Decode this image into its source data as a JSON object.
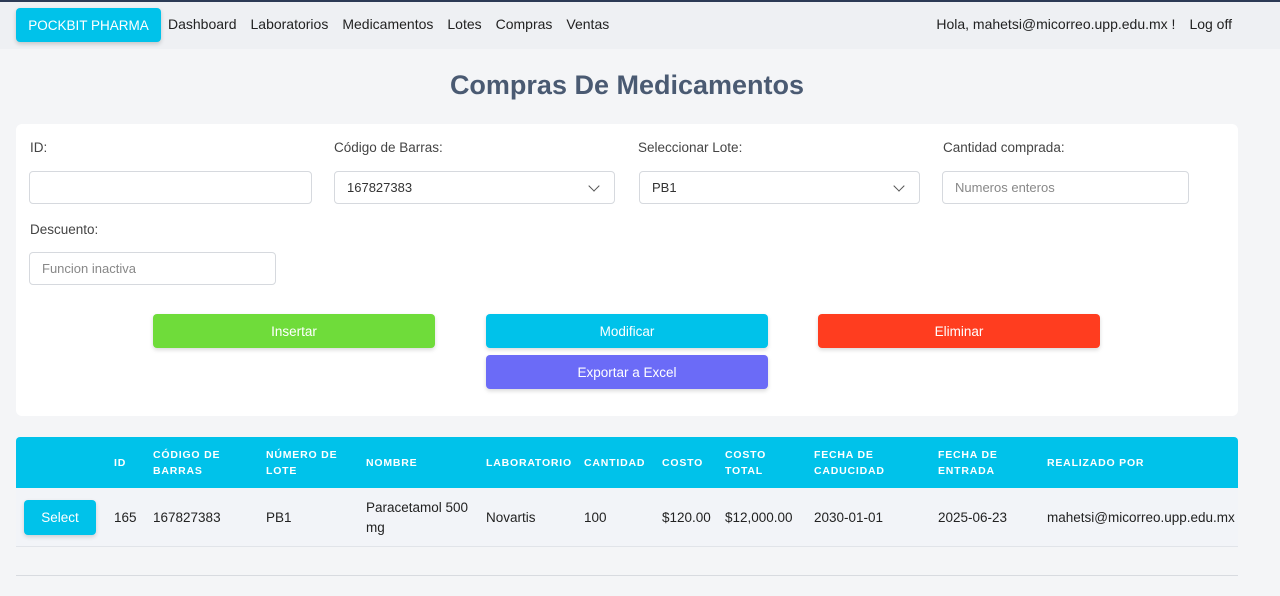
{
  "navbar": {
    "brand": "POCKBIT PHARMA",
    "links": [
      "Dashboard",
      "Laboratorios",
      "Medicamentos",
      "Lotes",
      "Compras",
      "Ventas"
    ],
    "greeting": "Hola, mahetsi@micorreo.upp.edu.mx !",
    "logoff": "Log off"
  },
  "page": {
    "title": "Compras De Medicamentos"
  },
  "form": {
    "id_label": "ID:",
    "id_value": "",
    "barcode_label": "Código de Barras:",
    "barcode_value": "167827383",
    "lote_label": "Seleccionar Lote:",
    "lote_value": "PB1",
    "cantidad_label": "Cantidad comprada:",
    "cantidad_placeholder": "Numeros enteros",
    "descuento_label": "Descuento:",
    "descuento_placeholder": "Funcion inactiva"
  },
  "actions": {
    "insert": "Insertar",
    "modify": "Modificar",
    "delete": "Eliminar",
    "export": "Exportar a Excel"
  },
  "colors": {
    "brand": "#00c2ea",
    "insert": "#6fdc3a",
    "modify": "#00c2ea",
    "delete": "#ff3d1f",
    "export": "#6b6bf7"
  },
  "table": {
    "headers": {
      "id": "ID",
      "barcode_1": "CÓDIGO DE",
      "barcode_2": "BARRAS",
      "lote_1": "NÚMERO DE",
      "lote_2": "LOTE",
      "nombre": "NOMBRE",
      "laboratorio": "LABORATORIO",
      "cantidad": "CANTIDAD",
      "costo": "COSTO",
      "costo_total_1": "COSTO",
      "costo_total_2": "TOTAL",
      "caducidad_1": "FECHA DE",
      "caducidad_2": "CADUCIDAD",
      "entrada_1": "FECHA DE",
      "entrada_2": "ENTRADA",
      "realizado": "REALIZADO POR"
    },
    "rows": [
      {
        "select": "Select",
        "id": "165",
        "barcode": "167827383",
        "lote": "PB1",
        "nombre": "Paracetamol 500 mg",
        "laboratorio": "Novartis",
        "cantidad": "100",
        "costo": "$120.00",
        "costo_total": "$12,000.00",
        "caducidad": "2030-01-01",
        "entrada": "2025-06-23",
        "realizado": "mahetsi@micorreo.upp.edu.mx"
      }
    ]
  }
}
